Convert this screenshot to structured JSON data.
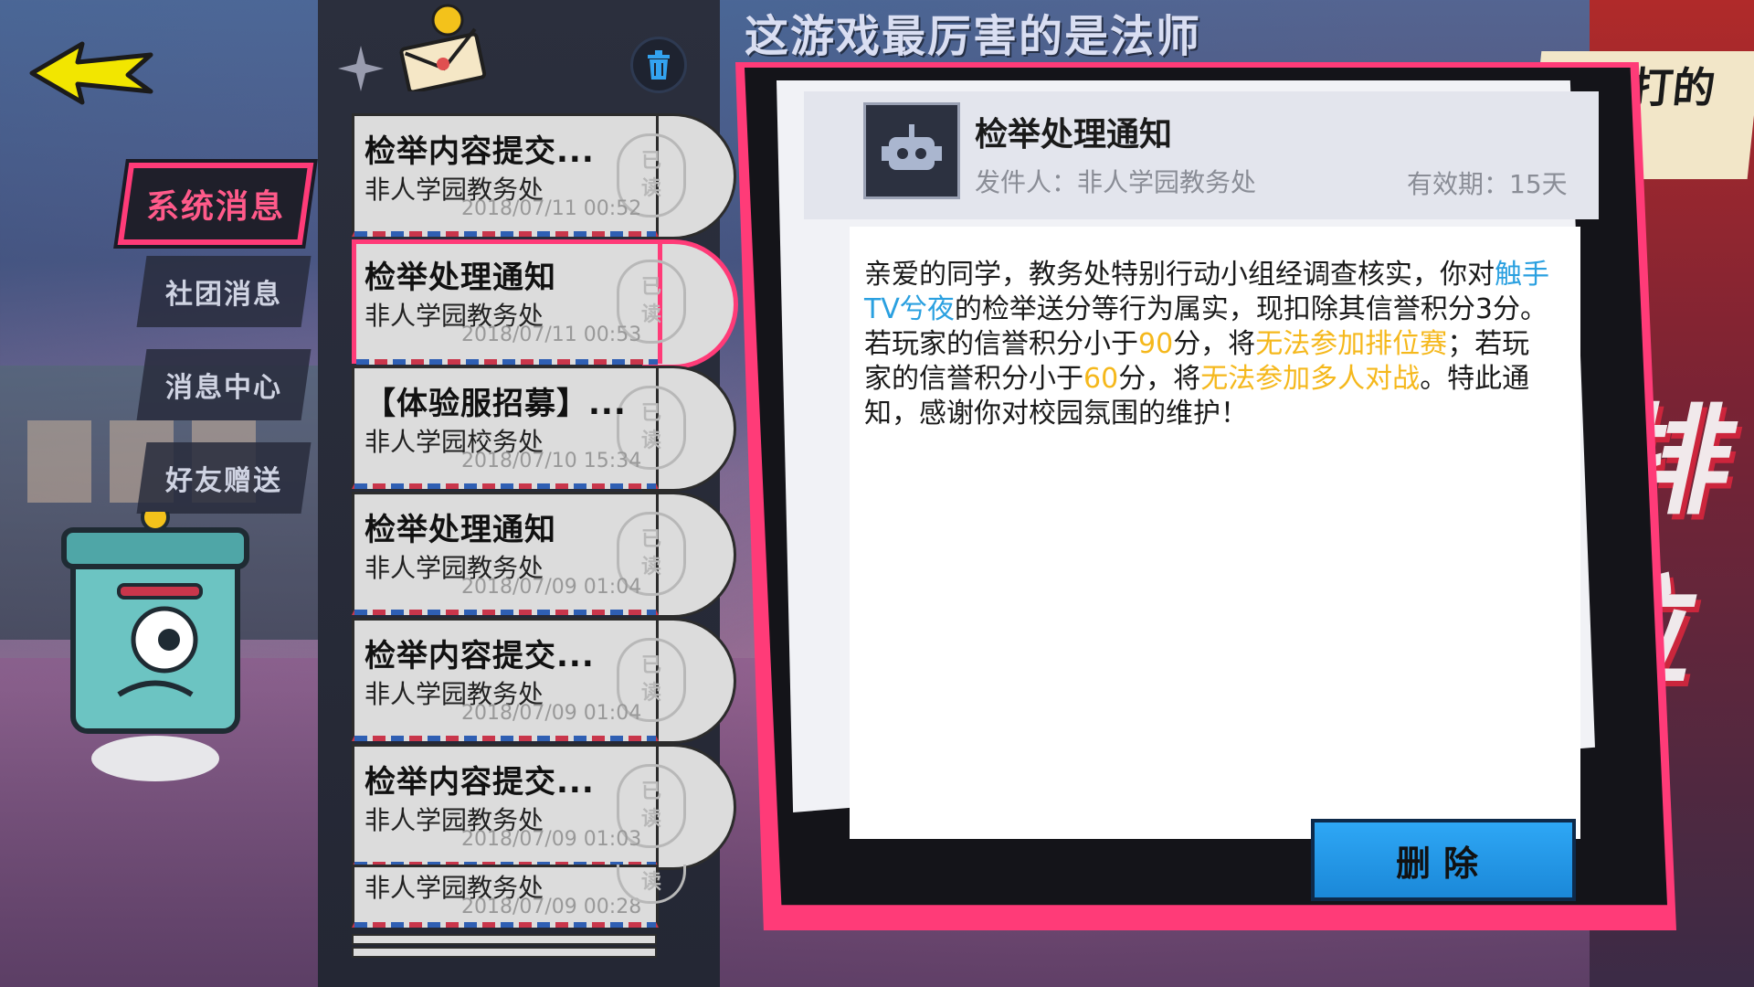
{
  "banner": "这游戏最厉害的是法师",
  "banner2": "昨天打的几",
  "background_glyph": "排位",
  "categories": [
    {
      "label": "系统消息",
      "active": true
    },
    {
      "label": "社团消息",
      "active": false
    },
    {
      "label": "消息中心",
      "active": false
    },
    {
      "label": "好友赠送",
      "active": false
    }
  ],
  "mails": [
    {
      "title": "检举内容提交...",
      "sender": "非人学园教务处",
      "date": "2018/07/11 00:52",
      "stamp": [
        "已",
        "读"
      ]
    },
    {
      "title": "检举处理通知",
      "sender": "非人学园教务处",
      "date": "2018/07/11 00:53",
      "stamp": [
        "已",
        "读"
      ]
    },
    {
      "title": "【体验服招募】...",
      "sender": "非人学园校务处",
      "date": "2018/07/10 15:34",
      "stamp": [
        "已",
        "读"
      ]
    },
    {
      "title": "检举处理通知",
      "sender": "非人学园教务处",
      "date": "2018/07/09 01:04",
      "stamp": [
        "已",
        "读"
      ]
    },
    {
      "title": "检举内容提交...",
      "sender": "非人学园教务处",
      "date": "2018/07/09 01:04",
      "stamp": [
        "已",
        "读"
      ]
    },
    {
      "title": "检举内容提交...",
      "sender": "非人学园教务处",
      "date": "2018/07/09 01:03",
      "stamp": [
        "已",
        "读"
      ]
    },
    {
      "title": "",
      "sender": "非人学园教务处",
      "date": "2018/07/09 00:28",
      "stamp": [
        "",
        "读"
      ]
    }
  ],
  "detail": {
    "title": "检举处理通知",
    "sender": "发件人：非人学园教务处",
    "expire": "有效期：15天",
    "p1_a": "亲爱的同学，教务处特别行动小组经调查核实，你对",
    "p1_name": "触手TV兮夜",
    "p1_b": "的检举送分等行为属实，现扣除其信誉积分3分。",
    "p2_a": "若玩家的信誉积分小于",
    "p2_n1": "90",
    "p2_b": "分，将",
    "p2_w1": "无法参加排位赛",
    "p2_c": "；若玩家的信誉积分小于",
    "p2_n2": "60",
    "p2_d": "分，将",
    "p2_w2": "无法参加多人对战",
    "p2_e": "。特此通知，感谢你对校园氛围的维护！"
  },
  "delete_label": "删除",
  "colors": {
    "accent": "#ff3b78",
    "link": "#2aa0e0",
    "highlight": "#f5b81c",
    "button": "#2ea7f5"
  }
}
